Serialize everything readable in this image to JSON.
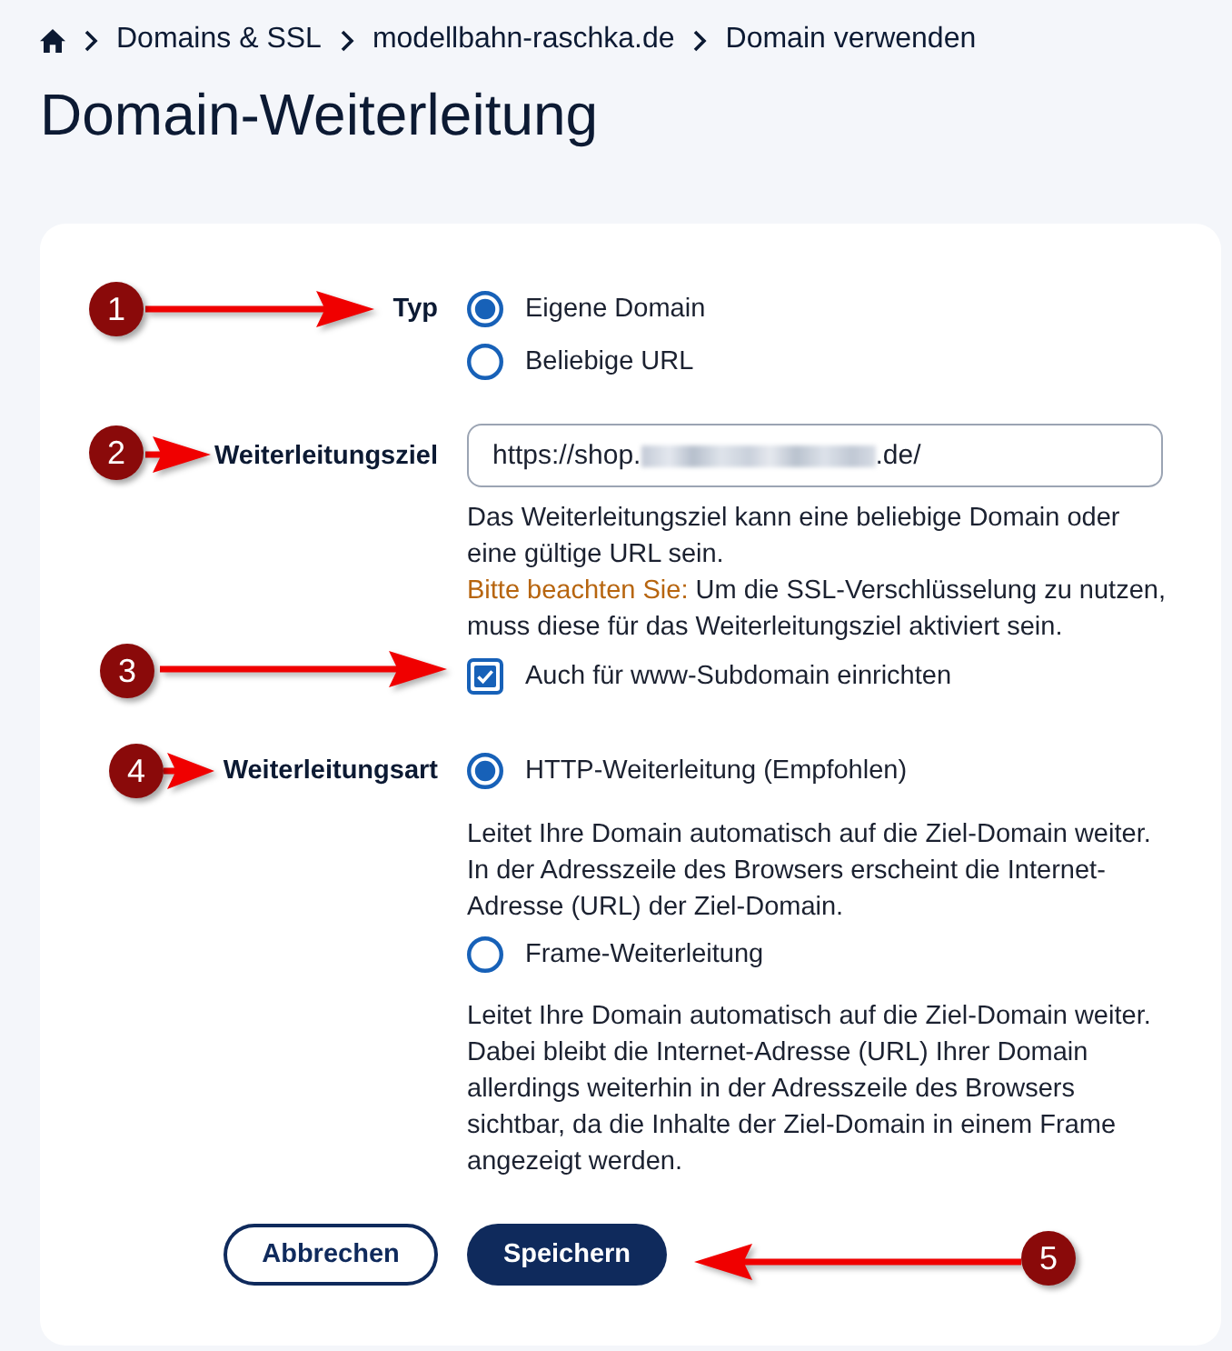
{
  "breadcrumb": [
    {
      "kind": "home"
    },
    {
      "kind": "link",
      "label": "Domains & SSL"
    },
    {
      "kind": "link",
      "label": "modellbahn-raschka.de"
    },
    {
      "kind": "current",
      "label": "Domain verwenden"
    }
  ],
  "title": "Domain-Weiterleitung",
  "type_field": {
    "label": "Typ",
    "options": [
      {
        "label": "Eigene Domain",
        "selected": true
      },
      {
        "label": "Beliebige URL",
        "selected": false
      }
    ]
  },
  "target_field": {
    "label": "Weiterleitungsziel",
    "value_start": "https://shop.",
    "redacted": true,
    "value_end": ".de/",
    "help": "Das Weiterleitungsziel kann eine beliebige Domain oder eine gültige URL sein.",
    "note": {
      "prefix": "Bitte beachten Sie:",
      "text": "Um die SSL-Verschlüsselung zu nutzen, muss diese für das Weiterleitungsziel aktiviert sein."
    },
    "www_checkbox": {
      "label": "Auch für www-Subdomain einrichten",
      "checked": true
    }
  },
  "redirect_type_field": {
    "label": "Weiterleitungsart",
    "options": [
      {
        "label": "HTTP-Weiterleitung (Empfohlen)",
        "selected": true,
        "description": "Leitet Ihre Domain automatisch auf die Ziel-Domain weiter. In der Adresszeile des Browsers erscheint die Internet-Adresse (URL) der Ziel-Domain."
      },
      {
        "label": "Frame-Weiterleitung",
        "selected": false,
        "description": "Leitet Ihre Domain automatisch auf die Ziel-Domain weiter. Dabei bleibt die Internet-Adresse (URL) Ihrer Domain allerdings weiterhin in der Adresszeile des Browsers sichtbar, da die Inhalte der Ziel-Domain in einem Frame angezeigt werden."
      }
    ]
  },
  "buttons": [
    {
      "kind": "secondary",
      "label": "Abbrechen"
    },
    {
      "kind": "primary",
      "label": "Speichern"
    }
  ],
  "annotations": [
    {
      "number": "1",
      "kind": "right"
    },
    {
      "number": "2",
      "kind": "right"
    },
    {
      "number": "3",
      "kind": "right"
    },
    {
      "number": "4",
      "kind": "right"
    },
    {
      "number": "5",
      "kind": "left"
    }
  ]
}
